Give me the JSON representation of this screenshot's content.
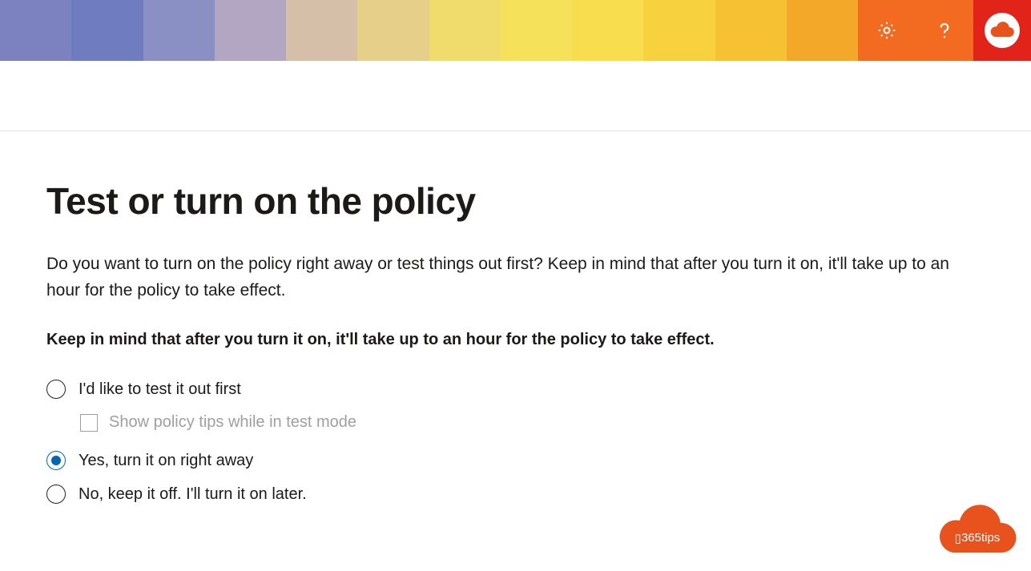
{
  "header": {
    "settings_icon": "gear-icon",
    "help_icon": "help-icon",
    "profile_icon": "profile-cloud-icon"
  },
  "page": {
    "title": "Test or turn on the policy",
    "intro": "Do you want to turn on the policy right away or test things out first? Keep in mind that after you turn it on, it'll take up to an hour for the policy to take effect.",
    "warning": "Keep in mind that after you turn it on, it'll take up to an hour for the policy to take effect."
  },
  "options": [
    {
      "id": "test",
      "label": "I'd like to test it out first",
      "selected": false,
      "sub": {
        "label": "Show policy tips while in test mode",
        "checked": false,
        "enabled": false
      }
    },
    {
      "id": "yes",
      "label": "Yes, turn it on right away",
      "selected": true
    },
    {
      "id": "no",
      "label": "No, keep it off. I'll turn it on later.",
      "selected": false
    }
  ],
  "watermark": {
    "label": "365tips"
  }
}
